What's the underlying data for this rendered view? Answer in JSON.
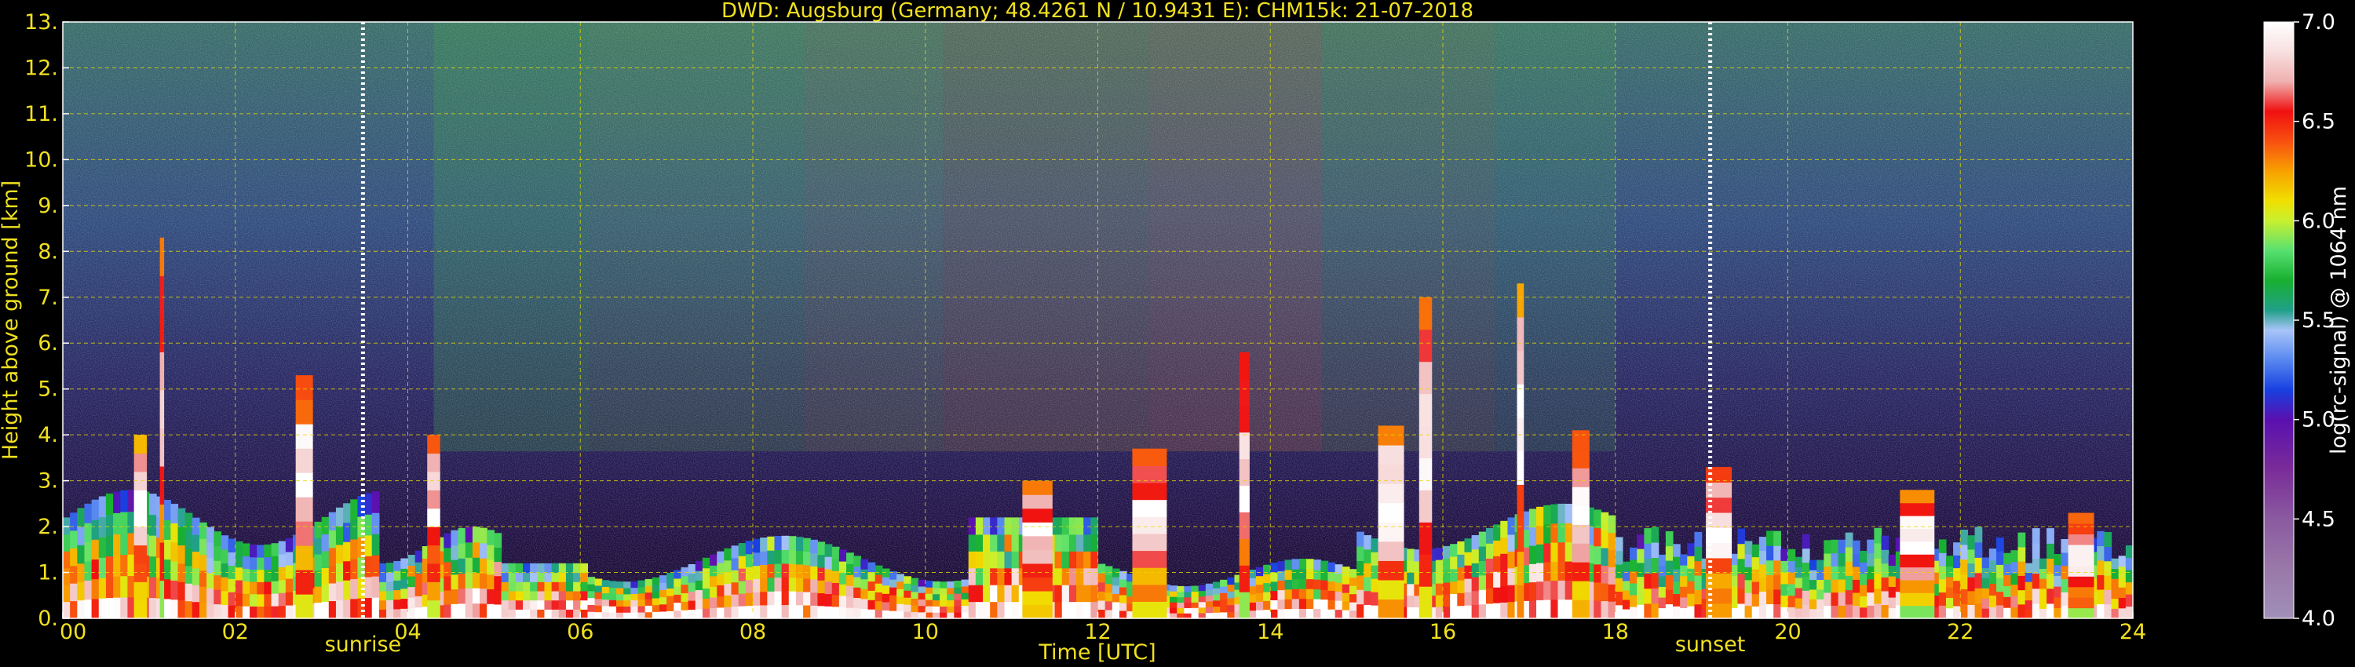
{
  "chart_data": {
    "type": "heatmap",
    "title": "DWD: Augsburg (Germany; 48.4261 N / 10.9431 E):    CHM15k: 21-07-2018",
    "xlabel": "Time [UTC]",
    "ylabel": "Height above ground [km]",
    "colorbar_label": "log(rc-signal) @ 1064 nm",
    "xlim": [
      0,
      24
    ],
    "ylim": [
      0,
      13
    ],
    "clim": [
      4.0,
      7.0
    ],
    "x_ticks": [
      {
        "value": 0,
        "label": "00"
      },
      {
        "value": 2,
        "label": "02"
      },
      {
        "value": 4,
        "label": "04"
      },
      {
        "value": 6,
        "label": "06"
      },
      {
        "value": 8,
        "label": "08"
      },
      {
        "value": 10,
        "label": "10"
      },
      {
        "value": 12,
        "label": "12"
      },
      {
        "value": 14,
        "label": "14"
      },
      {
        "value": 16,
        "label": "16"
      },
      {
        "value": 18,
        "label": "18"
      },
      {
        "value": 20,
        "label": "20"
      },
      {
        "value": 22,
        "label": "22"
      },
      {
        "value": 24,
        "label": "24"
      }
    ],
    "y_ticks": [
      {
        "value": 0,
        "label": "0."
      },
      {
        "value": 1,
        "label": "1."
      },
      {
        "value": 2,
        "label": "2."
      },
      {
        "value": 3,
        "label": "3."
      },
      {
        "value": 4,
        "label": "4."
      },
      {
        "value": 5,
        "label": "5."
      },
      {
        "value": 6,
        "label": "6."
      },
      {
        "value": 7,
        "label": "7."
      },
      {
        "value": 8,
        "label": "8."
      },
      {
        "value": 9,
        "label": "9."
      },
      {
        "value": 10,
        "label": "10."
      },
      {
        "value": 11,
        "label": "11."
      },
      {
        "value": 12,
        "label": "12."
      },
      {
        "value": 13,
        "label": "13."
      }
    ],
    "colorbar_ticks": [
      {
        "value": 4.0,
        "label": "4.0"
      },
      {
        "value": 4.5,
        "label": "4.5"
      },
      {
        "value": 5.0,
        "label": "5.0"
      },
      {
        "value": 5.5,
        "label": "5.5"
      },
      {
        "value": 6.0,
        "label": "6.0"
      },
      {
        "value": 6.5,
        "label": "6.5"
      },
      {
        "value": 7.0,
        "label": "7.0"
      }
    ],
    "colormap": [
      {
        "value": 4.0,
        "color": "#a090b8"
      },
      {
        "value": 4.25,
        "color": "#9a78a8"
      },
      {
        "value": 4.5,
        "color": "#8a5aa0"
      },
      {
        "value": 4.75,
        "color": "#7a2c98"
      },
      {
        "value": 5.0,
        "color": "#5a10b0"
      },
      {
        "value": 5.15,
        "color": "#1840e0"
      },
      {
        "value": 5.3,
        "color": "#5888f0"
      },
      {
        "value": 5.45,
        "color": "#a8c4f8"
      },
      {
        "value": 5.55,
        "color": "#20a088"
      },
      {
        "value": 5.7,
        "color": "#18b030"
      },
      {
        "value": 5.85,
        "color": "#58e070"
      },
      {
        "value": 6.0,
        "color": "#c8f030"
      },
      {
        "value": 6.1,
        "color": "#f0e000"
      },
      {
        "value": 6.25,
        "color": "#f8a000"
      },
      {
        "value": 6.4,
        "color": "#f85010"
      },
      {
        "value": 6.55,
        "color": "#f01010"
      },
      {
        "value": 6.7,
        "color": "#f0b0b0"
      },
      {
        "value": 6.85,
        "color": "#f8e0e0"
      },
      {
        "value": 7.0,
        "color": "#ffffff"
      }
    ],
    "markers": [
      {
        "name": "sunrise",
        "time": 3.48,
        "label": "sunrise"
      },
      {
        "name": "sunset",
        "time": 19.1,
        "label": "sunset"
      }
    ],
    "grid": true,
    "colors": {
      "text": "#f0e020",
      "axis": "#ffffff",
      "grid": "#e8d800",
      "background": "#000000"
    }
  }
}
